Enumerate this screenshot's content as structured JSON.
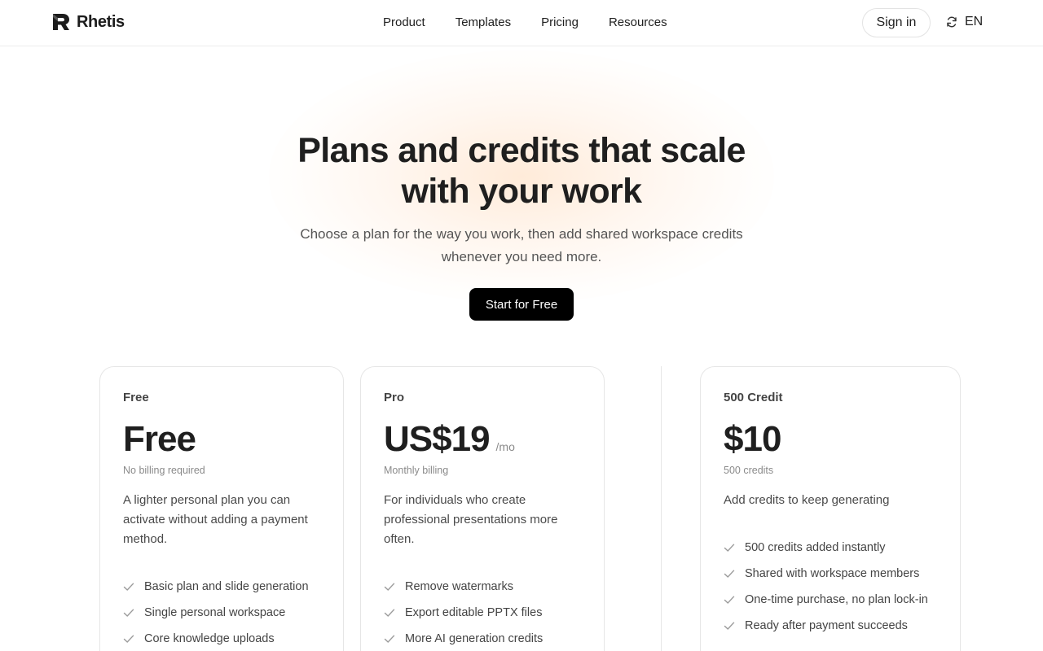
{
  "header": {
    "brand": "Rhetis",
    "nav": [
      "Product",
      "Templates",
      "Pricing",
      "Resources"
    ],
    "sign_in": "Sign in",
    "language": "EN"
  },
  "hero": {
    "title_line1": "Plans and credits that scale",
    "title_line2": "with your work",
    "subtitle_line1": "Choose a plan for the way you work, then add shared workspace credits",
    "subtitle_line2": "whenever you need more.",
    "cta": "Start for Free"
  },
  "plans": [
    {
      "name": "Free",
      "price": "Free",
      "period": "",
      "billing": "No billing required",
      "description": "A lighter personal plan you can activate without adding a payment method.",
      "features": [
        "Basic plan and slide generation",
        "Single personal workspace",
        "Core knowledge uploads"
      ]
    },
    {
      "name": "Pro",
      "price": "US$19",
      "period": "/mo",
      "billing": "Monthly billing",
      "description": "For individuals who create professional presentations more often.",
      "features": [
        "Remove watermarks",
        "Export editable PPTX files",
        "More AI generation credits"
      ]
    }
  ],
  "credit_pack": {
    "name": "500 Credit",
    "price": "$10",
    "billing": "500 credits",
    "description": "Add credits to keep generating",
    "features": [
      "500 credits added instantly",
      "Shared with workspace members",
      "One-time purchase, no plan lock-in",
      "Ready after payment succeeds"
    ]
  },
  "colors": {
    "cta_bg": "#000000",
    "check": "#9a9a9a",
    "glow": "#ffd9b8"
  }
}
